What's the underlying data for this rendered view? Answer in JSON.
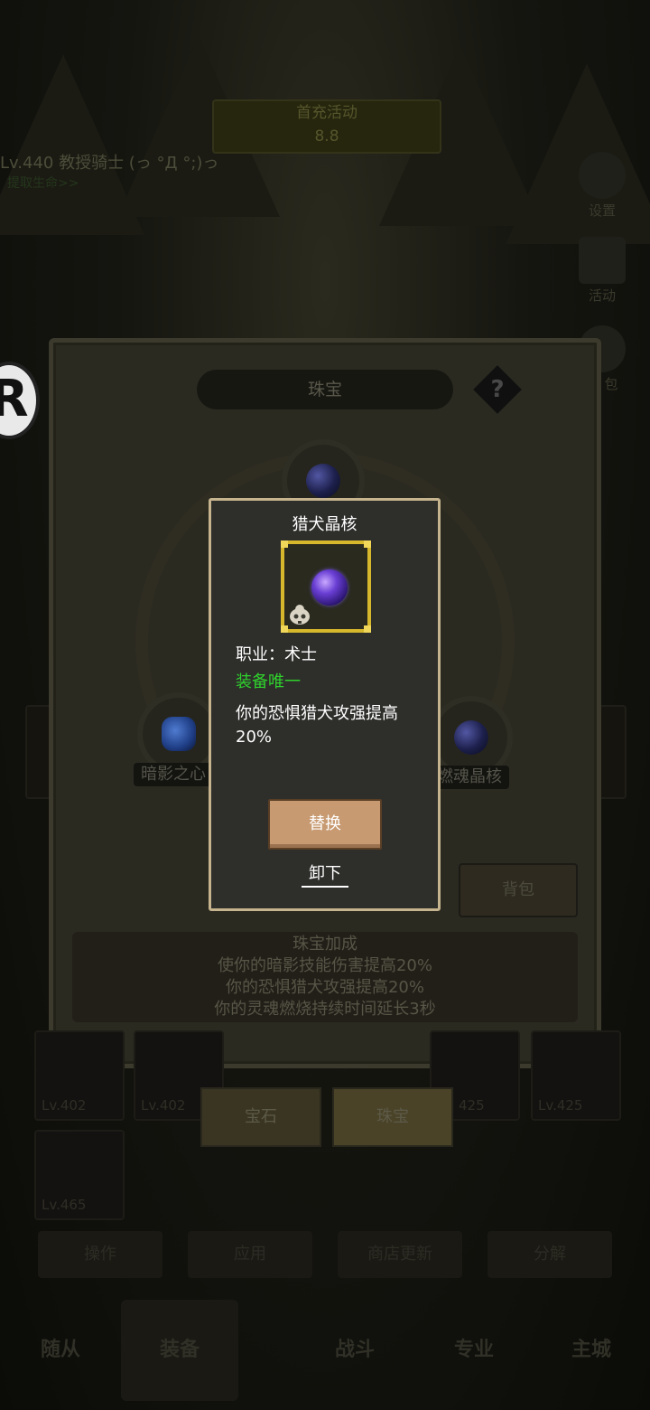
{
  "background": {
    "top_banner": [
      "首充活动",
      "8.8"
    ],
    "player_line": "Lv.440 教授骑士 (っ °Д °;)っ",
    "player_sub": "提取生命>>",
    "side_buttons": [
      {
        "label": "设置",
        "icon": "gear-icon"
      },
      {
        "label": "活动",
        "icon": "calendar-icon"
      },
      {
        "label": "包",
        "icon": "bag-icon"
      }
    ]
  },
  "panel": {
    "title": "珠宝",
    "help": "?",
    "slots": [
      {
        "label": "暗影之心",
        "gem": "blue-gem"
      },
      {
        "label": "燃魂晶核",
        "gem": "dark-orb"
      },
      {
        "label": "",
        "gem": "dark-orb"
      }
    ],
    "bag_button": "背包",
    "bonus": {
      "title": "珠宝加成",
      "lines": [
        "使你的暗影技能伤害提高20%",
        "你的恐惧猎犬攻强提高20%",
        "你的灵魂燃烧持续时间延长3秒"
      ]
    }
  },
  "tabs": [
    "宝石",
    "珠宝"
  ],
  "cards": [
    "Lv.402",
    "Lv.402",
    "425",
    "Lv.425",
    "Lv.465"
  ],
  "actions": [
    "操作",
    "应用",
    "商店更新",
    "分解"
  ],
  "nav": [
    "随从",
    "装备",
    "战斗",
    "专业",
    "主城"
  ],
  "popup": {
    "title": "猎犬晶核",
    "job": "职业：术士",
    "unique": "装备唯一",
    "effect": "你的恐惧猎犬攻强提高20%",
    "replace_button": "替换",
    "unequip_button": "卸下"
  },
  "colors": {
    "popup_border": "#c5b48e",
    "item_frame": "#d7b72b",
    "unique_text": "#2fd12c",
    "replace_button": "#c79a71"
  }
}
